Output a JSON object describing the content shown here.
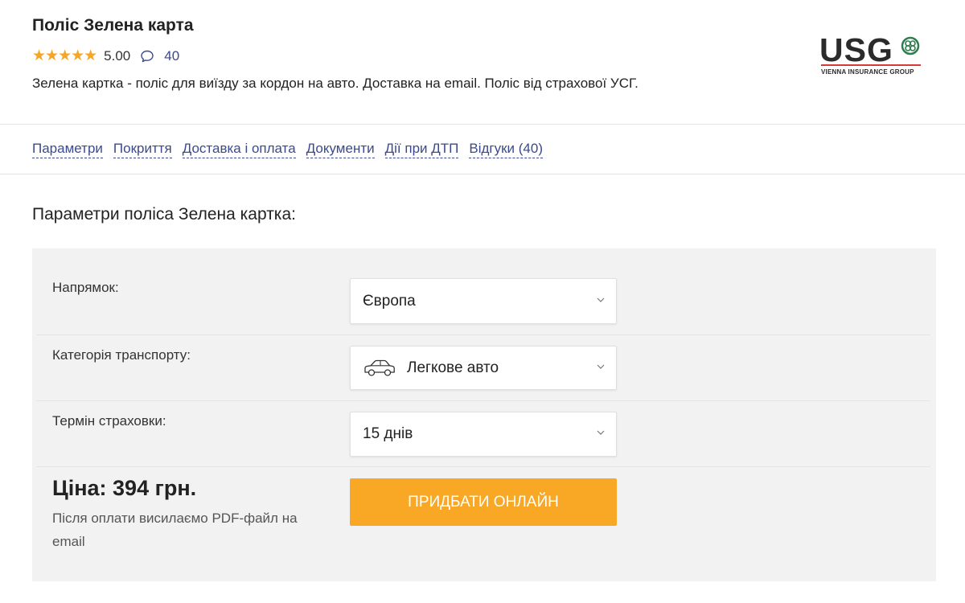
{
  "product": {
    "title": "Поліс Зелена карта",
    "stars": "★★★★★",
    "rating": "5.00",
    "reviews_count": "40",
    "description": "Зелена картка - поліс для виїзду за кордон на авто. Доставка на email. Поліс від страхової УСГ.",
    "rating_color": "#f5a623"
  },
  "logo": {
    "text": "USG",
    "subtitle": "VIENNA INSURANCE GROUP",
    "mark_color": "#2e7d4f",
    "line_color": "#d63b3b"
  },
  "nav": {
    "items": [
      {
        "label": "Параметри"
      },
      {
        "label": "Покриття"
      },
      {
        "label": "Доставка і оплата"
      },
      {
        "label": "Документи"
      },
      {
        "label": "Дії при ДТП"
      },
      {
        "label": "Відгуки (40)"
      }
    ]
  },
  "params": {
    "section_title": "Параметри поліса Зелена картка:",
    "direction": {
      "label": "Напрямок:",
      "value": "Європа"
    },
    "vehicle": {
      "label": "Категорія транспорту:",
      "value": "Легкове авто",
      "icon": "car-icon"
    },
    "term": {
      "label": "Термін страховки:",
      "value": "15 днів"
    },
    "price": "Ціна: 394 грн.",
    "price_note": "Після оплати висилаємо PDF-файл на email",
    "buy_label": "ПРИДБАТИ ОНЛАЙН",
    "buy_color": "#f9a826"
  }
}
